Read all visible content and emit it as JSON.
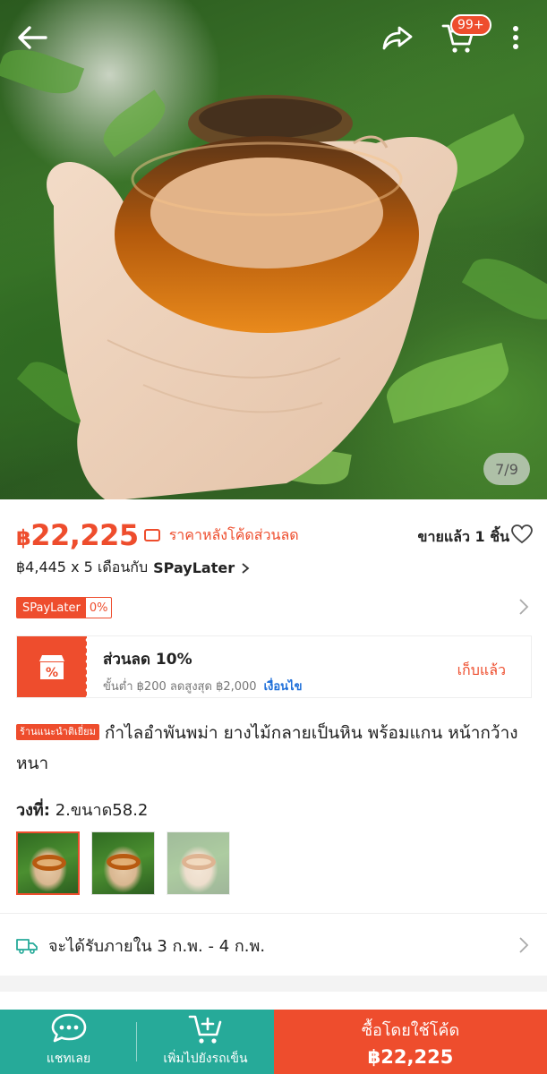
{
  "header": {
    "cart_badge": "99+",
    "image_counter": "7/9"
  },
  "price": {
    "currency": "฿",
    "amount": "22,225",
    "note": "ราคาหลังโค้ดส่วนลด",
    "sold": "ขายแล้ว 1 ชิ้น",
    "installment_prefix": "฿4,445 x 5 เดือนกับ",
    "installment_brand": "SPayLater",
    "badge_left": "SPayLater",
    "badge_right": "0%"
  },
  "voucher": {
    "title": "ส่วนลด 10%",
    "sub": "ขั้นต่ำ ฿200 ลดสูงสุด ฿2,000",
    "condition": "เงื่อนไข",
    "claim": "เก็บแล้ว"
  },
  "product": {
    "shop_tag": "ร้านแนะนำติเยี่ยม",
    "title": "กำไลอำพันพม่า ยางไม้กลายเป็นหิน พร้อมแกน หน้ากว้างหนา"
  },
  "variation": {
    "label": "วงที่:",
    "value": "2.ขนาด58.2"
  },
  "shipping": {
    "text": "จะได้รับภายใน 3 ก.พ. - 4 ก.พ."
  },
  "bottom": {
    "chat_label": "แชทเลย",
    "cart_label": "เพิ่มไปยังรถเข็น",
    "buy_label": "ซื้อโดยใช้โค้ด",
    "buy_price": "฿22,225"
  },
  "colors": {
    "accent": "#ee4d2d",
    "teal": "#26aa99",
    "link": "#1e6fd9"
  }
}
